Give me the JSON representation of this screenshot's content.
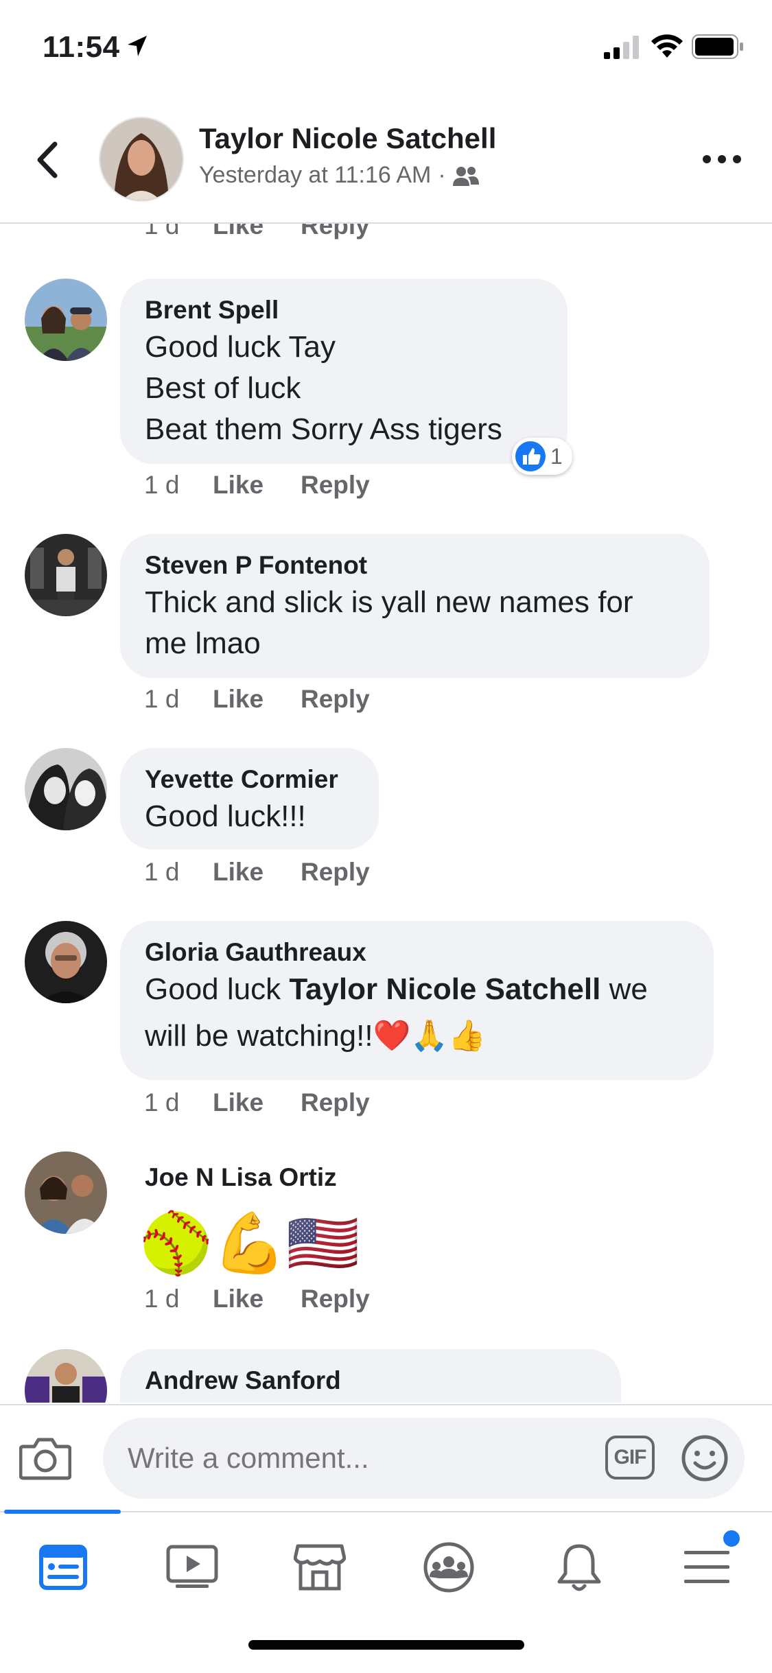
{
  "status_bar": {
    "time": "11:54"
  },
  "header": {
    "author_name": "Taylor Nicole Satchell",
    "timestamp": "Yesterday at 11:16 AM",
    "separator": "·",
    "audience_icon": "friends-icon"
  },
  "partial_top_action": {
    "age": "1 d",
    "like": "Like",
    "reply": "Reply"
  },
  "comments": [
    {
      "author": "Brent Spell",
      "lines": [
        "Good luck Tay",
        "Best of luck",
        "Beat them Sorry Ass tigers"
      ],
      "age": "1 d",
      "like": "Like",
      "reply": "Reply",
      "reaction_count": "1"
    },
    {
      "author": "Steven P Fontenot",
      "lines": [
        "Thick and slick is yall new names for",
        "me lmao"
      ],
      "age": "1 d",
      "like": "Like",
      "reply": "Reply"
    },
    {
      "author": "Yevette Cormier",
      "lines": [
        "Good luck!!!"
      ],
      "age": "1 d",
      "like": "Like",
      "reply": "Reply"
    },
    {
      "author": "Gloria Gauthreaux",
      "text_before": "Good luck ",
      "mention": "Taylor Nicole Satchell",
      "text_after": " we",
      "line2": "will be watching!!",
      "emojis": "❤️🙏👍",
      "age": "1 d",
      "like": "Like",
      "reply": "Reply"
    },
    {
      "author": "Joe N Lisa Ortiz",
      "emojis": "🥎💪🇺🇸",
      "age": "1 d",
      "like": "Like",
      "reply": "Reply"
    },
    {
      "author": "Andrew Sanford"
    }
  ],
  "composer": {
    "placeholder": "Write a comment...",
    "gif_label": "GIF"
  },
  "bottom_nav": {
    "items": [
      "news-feed-icon",
      "watch-icon",
      "marketplace-icon",
      "groups-icon",
      "notifications-icon",
      "menu-icon"
    ]
  },
  "colors": {
    "accent": "#1877f2",
    "bubble": "#f0f2f5",
    "secondary_text": "#65676b"
  }
}
